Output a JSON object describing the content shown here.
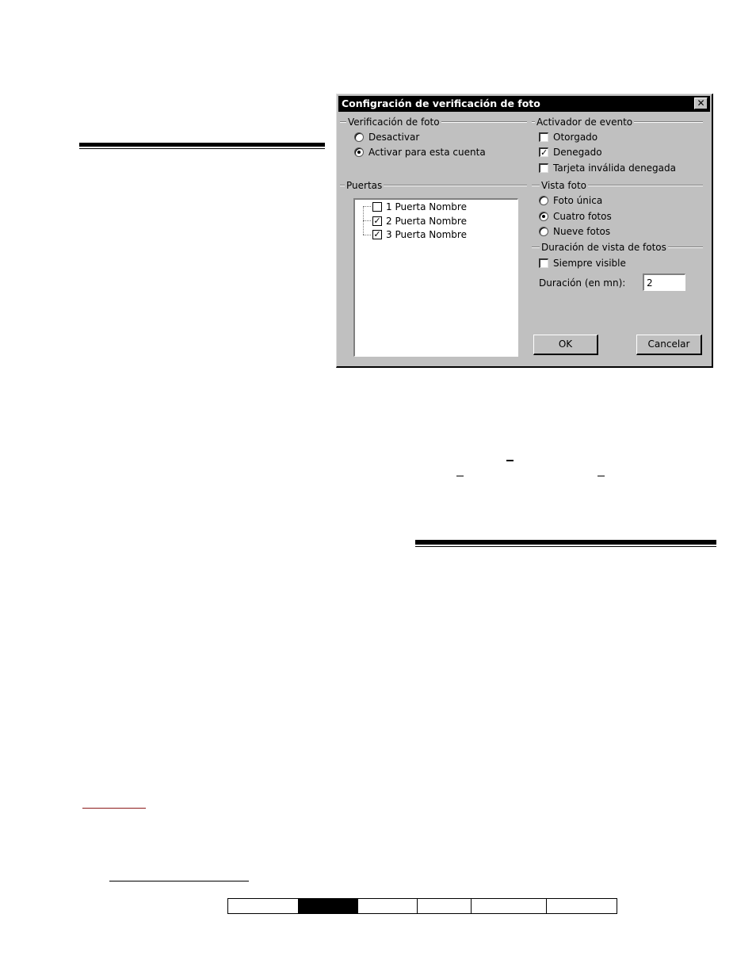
{
  "dialog": {
    "title": "Configración de verificación de foto",
    "close_symbol": "✕",
    "photo_verification": {
      "label": "Verificación de foto",
      "options": [
        {
          "label": "Desactivar",
          "selected": false
        },
        {
          "label": "Activar para esta cuenta",
          "selected": true
        }
      ]
    },
    "event_trigger": {
      "label": "Activador de evento",
      "options": [
        {
          "label": "Otorgado",
          "checked": false
        },
        {
          "label": "Denegado",
          "checked": true
        },
        {
          "label": "Tarjeta inválida denegada",
          "checked": false
        }
      ]
    },
    "doors": {
      "label": "Puertas",
      "items": [
        {
          "label": "1 Puerta Nombre",
          "checked": false
        },
        {
          "label": "2 Puerta Nombre",
          "checked": true
        },
        {
          "label": "3 Puerta Nombre",
          "checked": true
        }
      ]
    },
    "photo_view": {
      "label": "Vista foto",
      "options": [
        {
          "label": "Foto única",
          "selected": false
        },
        {
          "label": "Cuatro fotos",
          "selected": true
        },
        {
          "label": "Nueve fotos",
          "selected": false
        }
      ]
    },
    "photo_view_duration": {
      "label": "Duración de vista de fotos",
      "always_visible": {
        "label": "Siempre visible",
        "checked": false
      },
      "duration_label": "Duración (en mn):",
      "duration_value": "2"
    },
    "buttons": {
      "ok": "OK",
      "cancel": "Cancelar"
    }
  },
  "check_mark": "✓"
}
